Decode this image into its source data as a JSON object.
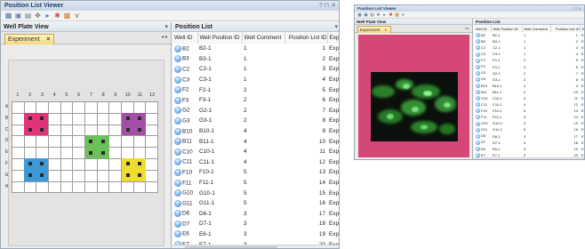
{
  "main": {
    "title": "Position List Viewer",
    "controls": "? ⊓ ✕",
    "toolbar_icons": [
      "grid-view-icon",
      "save-icon",
      "open-icon",
      "move-icon",
      "play-icon",
      "star-icon",
      "image-icon",
      "filter-icon"
    ],
    "left_pane": {
      "title": "Well Plate View",
      "tab_label": "Experiment",
      "tab_close": "×",
      "tab_nav": "◂ ▸",
      "columns": [
        "1",
        "2",
        "3",
        "4",
        "5",
        "6",
        "7",
        "8",
        "9",
        "10",
        "11",
        "12"
      ],
      "rows": [
        "A",
        "B",
        "C",
        "D",
        "E",
        "F",
        "G",
        "H"
      ],
      "well_colors": {
        "B2": "#e0337a",
        "B10": "#a34fa8",
        "D7": "#6cc25a",
        "F2": "#3d9ad6",
        "F10": "#eedd30"
      }
    },
    "right_pane": {
      "title": "Position List",
      "headers": [
        "Well ID",
        "Well Position ID",
        "Well Comment",
        "Position List ID",
        "Expe"
      ],
      "rows": [
        [
          "B2",
          "B2-1",
          "1",
          "1",
          "Expe"
        ],
        [
          "B3",
          "B3-1",
          "1",
          "2",
          "Expe"
        ],
        [
          "C2",
          "C2-1",
          "1",
          "3",
          "Expe"
        ],
        [
          "C3",
          "C3-1",
          "1",
          "4",
          "Expe"
        ],
        [
          "F2",
          "F2-1",
          "2",
          "5",
          "Expe"
        ],
        [
          "F3",
          "F3-1",
          "2",
          "6",
          "Expe"
        ],
        [
          "G2",
          "G2-1",
          "2",
          "7",
          "Expe"
        ],
        [
          "G3",
          "G3-1",
          "2",
          "8",
          "Expe"
        ],
        [
          "B10",
          "B10-1",
          "4",
          "9",
          "Expe"
        ],
        [
          "B11",
          "B11-1",
          "4",
          "10",
          "Expe"
        ],
        [
          "C10",
          "C10-1",
          "4",
          "11",
          "Expe"
        ],
        [
          "C11",
          "C11-1",
          "4",
          "12",
          "Expe"
        ],
        [
          "F10",
          "F10-1",
          "5",
          "13",
          "Expe"
        ],
        [
          "F11",
          "F11-1",
          "5",
          "14",
          "Expe"
        ],
        [
          "G10",
          "G10-1",
          "5",
          "15",
          "Expe"
        ],
        [
          "G11",
          "G11-1",
          "5",
          "16",
          "Expe"
        ],
        [
          "D6",
          "D6-1",
          "3",
          "17",
          "Expe"
        ],
        [
          "D7",
          "D7-1",
          "3",
          "18",
          "Expe"
        ],
        [
          "E6",
          "E6-1",
          "3",
          "19",
          "Expe"
        ],
        [
          "E7",
          "E7-1",
          "3",
          "20",
          "Expe"
        ]
      ]
    }
  },
  "thumb": {
    "title": "Position List Viewer",
    "controls": "? ⊓ ✕",
    "left_title": "Well Plate View",
    "tab_label": "Experiment",
    "tab_close": "×",
    "tab_nav": "◂ ▸",
    "right_title": "Position List",
    "headers": [
      "Well ID",
      "Well Position ID",
      "Well Comment",
      "Position List ID",
      "E"
    ],
    "rows": [
      [
        "B2",
        "B2-1",
        "1",
        "1",
        "E"
      ],
      [
        "B3",
        "B3-1",
        "1",
        "2",
        "E"
      ],
      [
        "C2",
        "C2-1",
        "1",
        "3",
        "E"
      ],
      [
        "C3",
        "C3-1",
        "1",
        "4",
        "E"
      ],
      [
        "F2",
        "F2-1",
        "2",
        "5",
        "E"
      ],
      [
        "F3",
        "F3-1",
        "2",
        "6",
        "E"
      ],
      [
        "G2",
        "G2-1",
        "2",
        "7",
        "E"
      ],
      [
        "G3",
        "G3-1",
        "2",
        "8",
        "E"
      ],
      [
        "B10",
        "B10-1",
        "4",
        "9",
        "E"
      ],
      [
        "B11",
        "B11-1",
        "4",
        "10",
        "E"
      ],
      [
        "C10",
        "C10-1",
        "4",
        "11",
        "E"
      ],
      [
        "C11",
        "C11-1",
        "4",
        "12",
        "E"
      ],
      [
        "F10",
        "F10-1",
        "5",
        "13",
        "E"
      ],
      [
        "F11",
        "F11-1",
        "5",
        "14",
        "E"
      ],
      [
        "G10",
        "G10-1",
        "5",
        "15",
        "E"
      ],
      [
        "G11",
        "G11-1",
        "5",
        "16",
        "E"
      ],
      [
        "D6",
        "D6-1",
        "3",
        "17",
        "E"
      ],
      [
        "D7",
        "D7-1",
        "3",
        "18",
        "E"
      ],
      [
        "E6",
        "E6-1",
        "3",
        "19",
        "E"
      ],
      [
        "E7",
        "E7-1",
        "3",
        "20",
        "E"
      ]
    ],
    "image_bg": "#d64677"
  }
}
